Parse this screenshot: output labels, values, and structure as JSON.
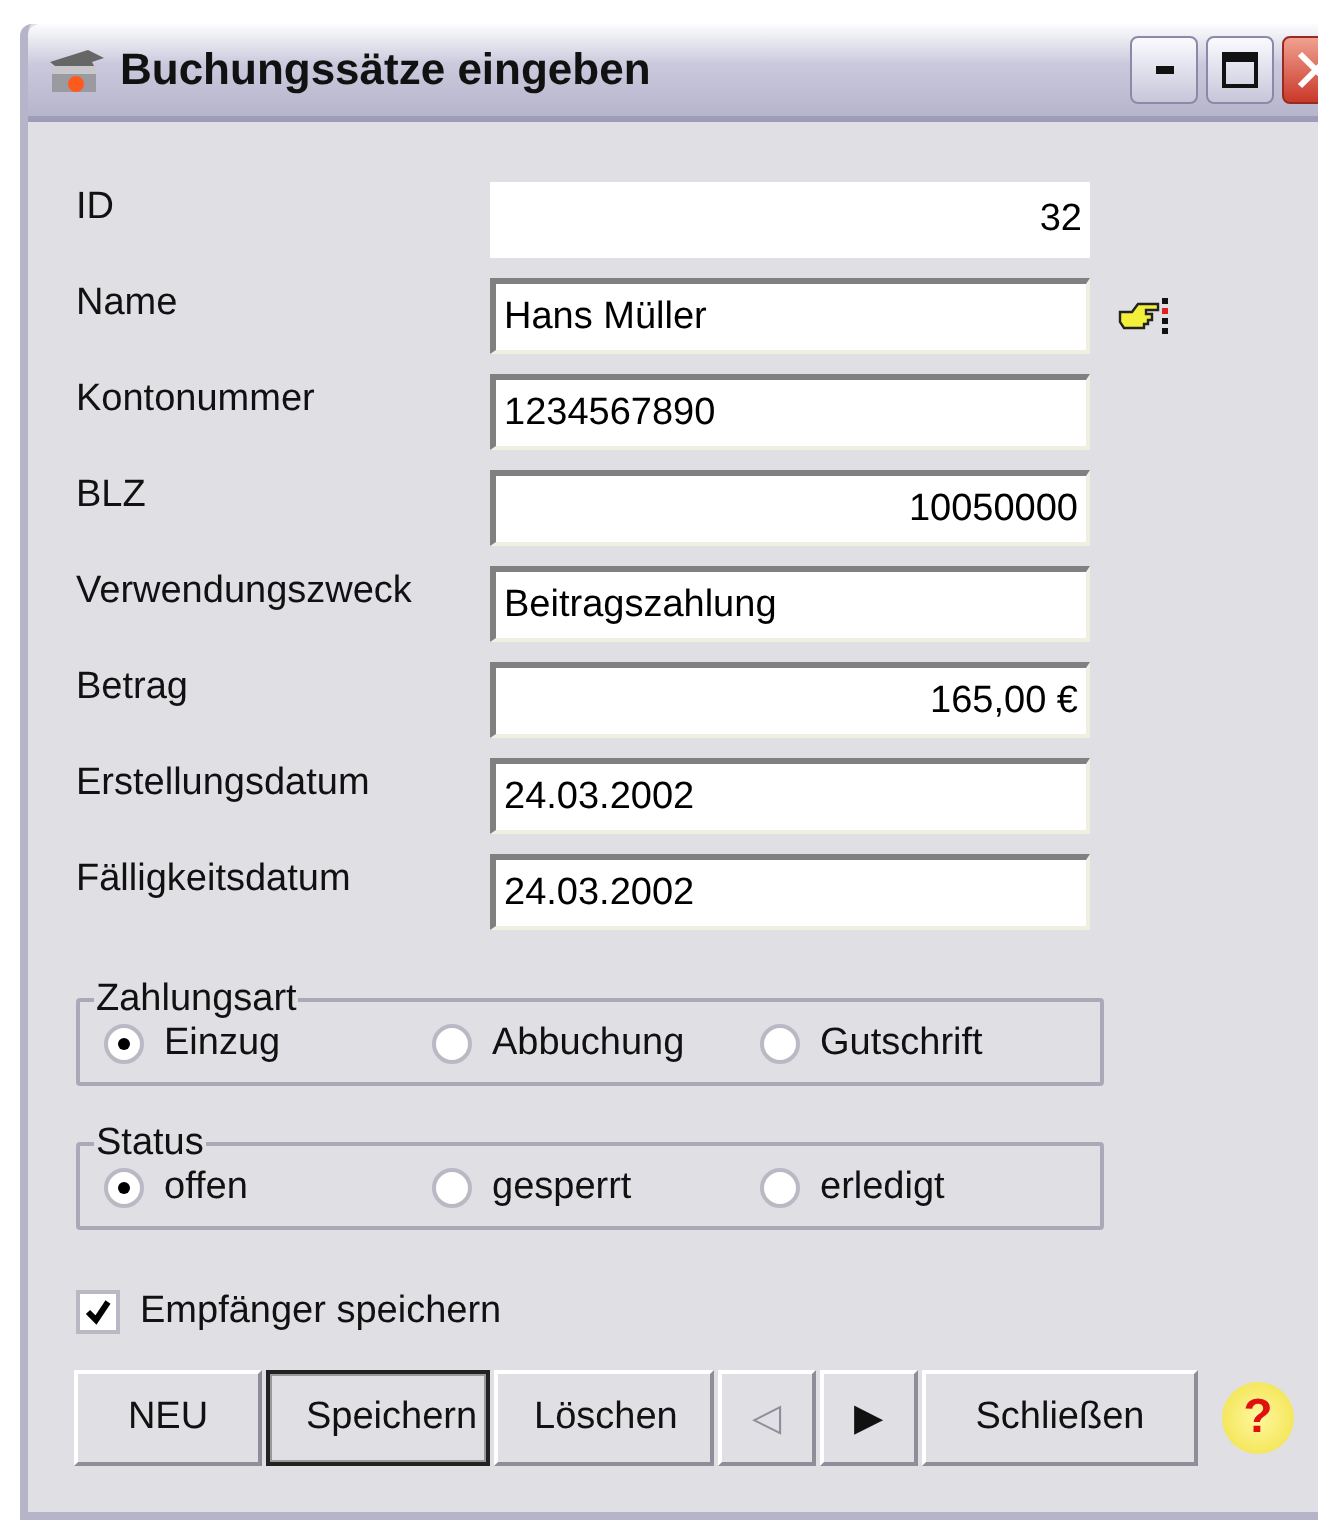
{
  "window": {
    "title": "Buchungssätze eingeben"
  },
  "fields": [
    {
      "label": "ID",
      "value": "32",
      "kind": "number",
      "readonly": true,
      "picker": false
    },
    {
      "label": "Name",
      "value": "Hans Müller",
      "kind": "text",
      "readonly": false,
      "picker": true
    },
    {
      "label": "Kontonummer",
      "value": "1234567890",
      "kind": "text",
      "readonly": false,
      "picker": false
    },
    {
      "label": "BLZ",
      "value": "10050000",
      "kind": "number",
      "readonly": false,
      "picker": false
    },
    {
      "label": "Verwendungszweck",
      "value": "Beitragszahlung",
      "kind": "text",
      "readonly": false,
      "picker": false
    },
    {
      "label": "Betrag",
      "value": "165,00 €",
      "kind": "number",
      "readonly": false,
      "picker": false
    },
    {
      "label": "Erstellungsdatum",
      "value": "24.03.2002",
      "kind": "text",
      "readonly": false,
      "picker": false
    },
    {
      "label": "Fälligkeitsdatum",
      "value": "24.03.2002",
      "kind": "text",
      "readonly": false,
      "picker": false
    }
  ],
  "groups": [
    {
      "title": "Zahlungsart",
      "options": [
        {
          "label": "Einzug",
          "selected": true
        },
        {
          "label": "Abbuchung",
          "selected": false
        },
        {
          "label": "Gutschrift",
          "selected": false
        }
      ]
    },
    {
      "title": "Status",
      "options": [
        {
          "label": "offen",
          "selected": true
        },
        {
          "label": "gesperrt",
          "selected": false
        },
        {
          "label": "erledigt",
          "selected": false
        }
      ]
    }
  ],
  "save_recipient": {
    "label": "Empfänger speichern",
    "checked": true
  },
  "buttons": [
    {
      "label": "NEU",
      "focused": false,
      "disabled": false
    },
    {
      "label": "Speichern",
      "focused": true,
      "disabled": false
    },
    {
      "label": "Löschen",
      "focused": false,
      "disabled": false
    },
    {
      "label": "◁",
      "focused": false,
      "disabled": true
    },
    {
      "label": "▶",
      "focused": false,
      "disabled": false
    },
    {
      "label": "Schließen",
      "focused": false,
      "disabled": false
    }
  ],
  "help": "?"
}
